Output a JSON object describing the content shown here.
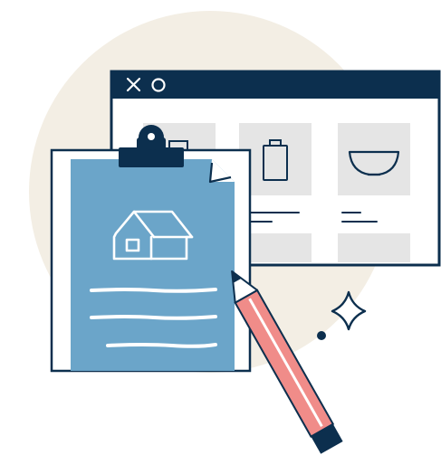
{
  "illustration": {
    "subject": "clipboard-with-house-and-pencil-over-browser-window",
    "colors": {
      "background": "#ffffff",
      "circle": "#F3EEE4",
      "navy": "#0C2F4E",
      "clipboard_blue": "#6BA5C9",
      "placeholder_gray": "#E5E5E5",
      "pencil_body": "#F08C89",
      "pencil_tip": "#0C2F4E",
      "white": "#ffffff"
    },
    "browser_window": {
      "controls": [
        "close-icon",
        "circle-icon"
      ]
    },
    "product_tiles": [
      "box-icon",
      "battery-icon",
      "bowl-icon"
    ],
    "clipboard": {
      "icon": "house-icon",
      "lines": 3
    },
    "decorations": [
      "sparkle-icon",
      "dot"
    ]
  }
}
